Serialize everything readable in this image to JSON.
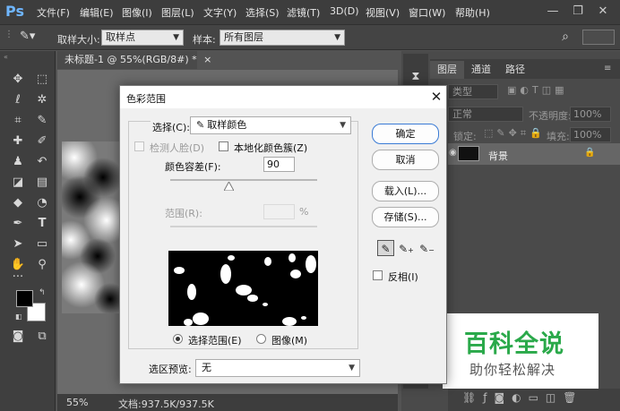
{
  "menubar": {
    "logo": "Ps",
    "items": [
      "文件(F)",
      "编辑(E)",
      "图像(I)",
      "图层(L)",
      "文字(Y)",
      "选择(S)",
      "滤镜(T)",
      "3D(D)",
      "视图(V)",
      "窗口(W)",
      "帮助(H)"
    ],
    "minimize": "—",
    "restore": "❐",
    "close": "✕"
  },
  "options_bar": {
    "sample_size_label": "取样大小:",
    "sample_size_value": "取样点",
    "sample_label": "样本:",
    "sample_value": "所有图层"
  },
  "document": {
    "tab_title": "未标题-1 @ 55%(RGB/8#) *",
    "tab_close": "×",
    "zoom": "55%",
    "doc_info": "文档:937.5K/937.5K"
  },
  "panels": {
    "tabs": [
      "图层",
      "通道",
      "路径"
    ],
    "filter_kind": "类型",
    "blend_mode": "正常",
    "opacity_label": "不透明度:",
    "opacity_value": "100%",
    "lock_label": "锁定:",
    "fill_label": "填充:",
    "fill_value": "100%",
    "layer_name": "背景"
  },
  "dialog": {
    "title": "色彩范围",
    "close": "✕",
    "select_label": "选择(C):",
    "select_value": "取样颜色",
    "detect_faces": "检测人脸(D)",
    "localized_clusters": "本地化颜色簇(Z)",
    "fuzziness_label": "颜色容差(F):",
    "fuzziness_value": "90",
    "fuzziness_level": 0.4,
    "range_label": "范围(R):",
    "range_unit": "%",
    "radio_selection": "选择范围(E)",
    "radio_image": "图像(M)",
    "preview_label": "选区预览:",
    "preview_value": "无",
    "btn_ok": "确定",
    "btn_cancel": "取消",
    "btn_load": "载入(L)...",
    "btn_save": "存储(S)...",
    "invert_label": "反相(I)"
  },
  "watermark": {
    "title": "百科全说",
    "subtitle": "助你轻松解决",
    "color": "#2aa94a"
  }
}
